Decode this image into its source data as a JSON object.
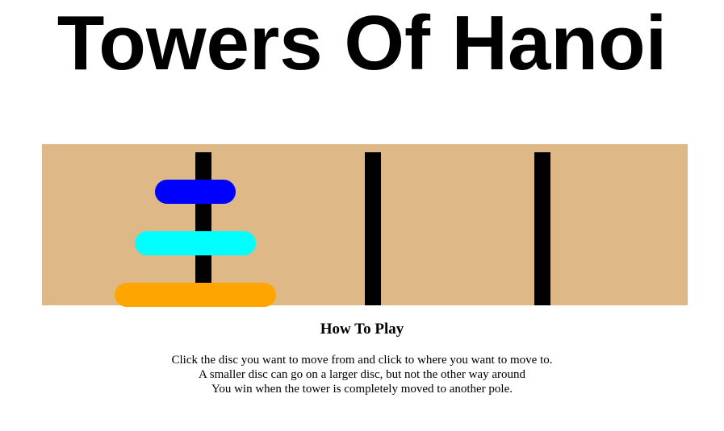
{
  "title": "Towers Of Hanoi",
  "board": {
    "color": "#deb887",
    "pole_color": "#000000",
    "poles": [
      {
        "id": 1,
        "discs": [
          {
            "size": 3,
            "color": "#ffa500"
          },
          {
            "size": 2,
            "color": "#00ffff"
          },
          {
            "size": 1,
            "color": "#0000ff"
          }
        ]
      },
      {
        "id": 2,
        "discs": []
      },
      {
        "id": 3,
        "discs": []
      }
    ]
  },
  "instructions": {
    "heading": "How To Play",
    "lines": [
      "Click the disc you want to move from and click to where you want to move to.",
      "A smaller disc can go on a larger disc, but not the other way around",
      "You win when the tower is completely moved to another pole."
    ]
  }
}
